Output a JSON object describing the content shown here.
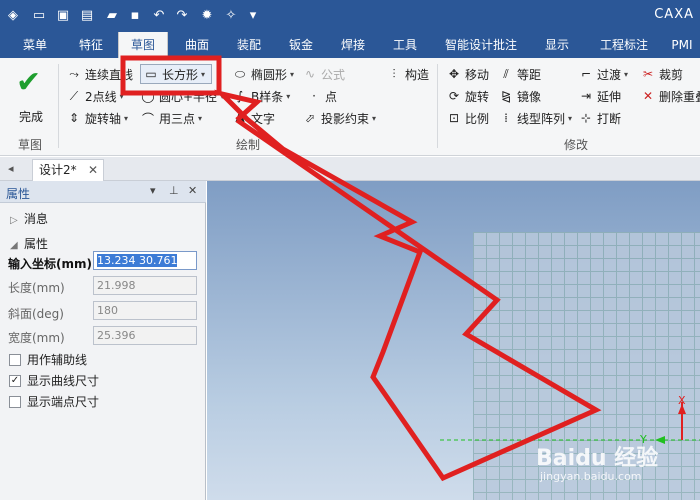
{
  "app": {
    "title": "CAXA"
  },
  "quick_access": [
    {
      "icon": "app-logo-icon",
      "glyph": "◈"
    },
    {
      "icon": "new-file-icon",
      "glyph": "▭"
    },
    {
      "icon": "new-drawing-icon",
      "glyph": "▣"
    },
    {
      "icon": "open-recent-icon",
      "glyph": "▤"
    },
    {
      "icon": "open-folder-icon",
      "glyph": "▰"
    },
    {
      "icon": "save-icon",
      "glyph": "▪"
    },
    {
      "icon": "undo-icon",
      "glyph": "↶"
    },
    {
      "icon": "redo-icon",
      "glyph": "↷"
    },
    {
      "icon": "settings-icon",
      "glyph": "✹"
    },
    {
      "icon": "sparkle-icon",
      "glyph": "✧"
    },
    {
      "icon": "customize-icon",
      "glyph": "▾"
    }
  ],
  "tabs": [
    "菜单",
    "特征",
    "草图",
    "曲面",
    "装配",
    "钣金",
    "焊接",
    "工具",
    "智能设计批注",
    "显示",
    "工程标注",
    "PMI"
  ],
  "active_tab": "草图",
  "ribbon": {
    "finish_label": "完成",
    "sketch_group_label": "草图",
    "draw_group_label": "绘制",
    "modify_group_label": "修改",
    "draw": {
      "continuous_line": "连续直线",
      "rectangle": "长方形",
      "ellipse": "椭圆形",
      "formula": "公式",
      "construct": "构造",
      "two_point_line": "2点线",
      "circle_center_radius": "圆心+半径",
      "bspline": "B样条",
      "point": "点",
      "rotation_axis": "旋转轴",
      "three_point_arc": "用三点",
      "text": "文字",
      "projection_constraint": "投影约束"
    },
    "modify": {
      "move": "移动",
      "offset": "等距",
      "transition": "过渡",
      "trim": "裁剪",
      "rotate": "旋转",
      "mirror": "镜像",
      "extend": "延伸",
      "delete_overlap": "删除重叠",
      "scale": "比例",
      "linear_array": "线型阵列",
      "break": "打断"
    }
  },
  "document_tab": {
    "name": "设计2*"
  },
  "properties_panel": {
    "title": "属性",
    "section_messages": "消息",
    "section_properties": "属性",
    "fields": [
      {
        "label": "输入坐标(mm)",
        "value": "13.234 30.761",
        "active": true
      },
      {
        "label": "长度(mm)",
        "value": "21.998"
      },
      {
        "label": "斜面(deg)",
        "value": "180"
      },
      {
        "label": "宽度(mm)",
        "value": "25.396"
      }
    ],
    "checkboxes": [
      {
        "label": "用作辅助线",
        "checked": false
      },
      {
        "label": "显示曲线尺寸",
        "checked": true
      },
      {
        "label": "显示端点尺寸",
        "checked": false
      }
    ]
  },
  "axes": {
    "x_label": "X",
    "y_label": "Y"
  },
  "watermark": {
    "main": "Baidu 经验",
    "sub": "jingyan.baidu.com"
  },
  "colors": {
    "titlebar": "#2b5797",
    "highlight_box": "#e02020",
    "annotation_arrow": "#e02020",
    "axis_green": "#20c020",
    "axis_red": "#e02020"
  }
}
